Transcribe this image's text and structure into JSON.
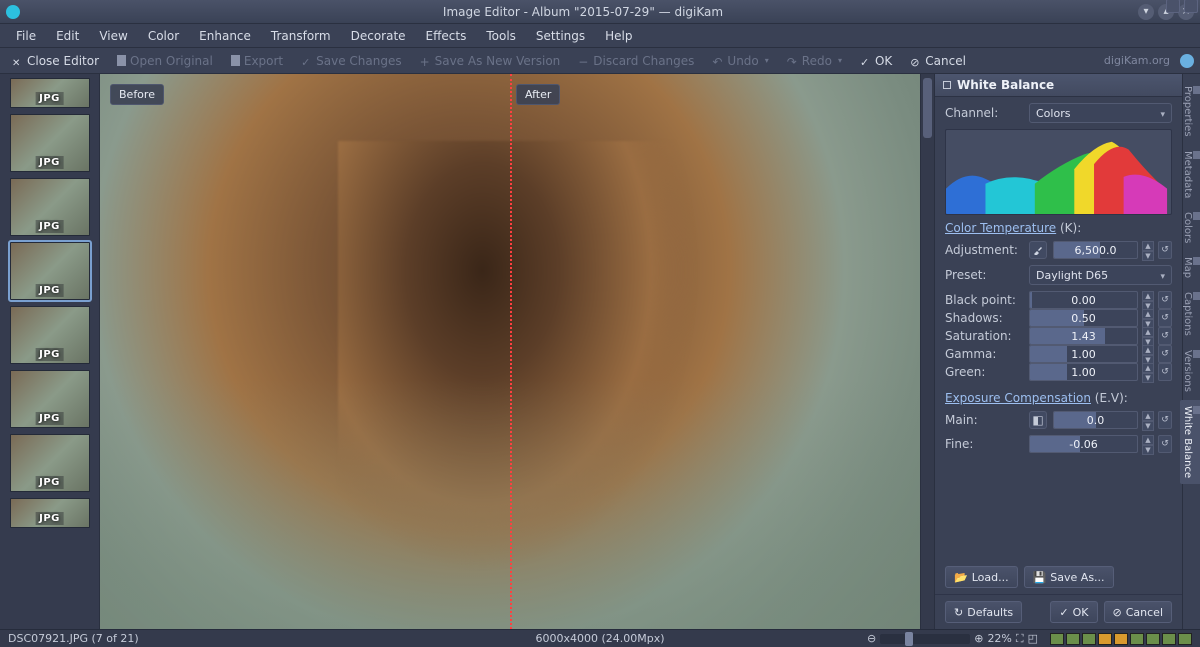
{
  "titlebar": {
    "title": "Image Editor - Album \"2015-07-29\" — digiKam"
  },
  "menubar": [
    "File",
    "Edit",
    "View",
    "Color",
    "Enhance",
    "Transform",
    "Decorate",
    "Effects",
    "Tools",
    "Settings",
    "Help"
  ],
  "toolbar": {
    "close": "Close Editor",
    "open": "Open Original",
    "export": "Export",
    "save": "Save Changes",
    "save_as": "Save As New Version",
    "discard": "Discard Changes",
    "undo": "Undo",
    "redo": "Redo",
    "ok": "OK",
    "cancel": "Cancel",
    "brand": "digiKam.org"
  },
  "thumbs": {
    "badge": "JPG",
    "count": 6
  },
  "canvas": {
    "before": "Before",
    "after": "After"
  },
  "panel": {
    "title": "White Balance",
    "channel_label": "Channel:",
    "channel_value": "Colors",
    "section_temp": "Color Temperature",
    "section_temp_unit": " (K):",
    "adjustment_label": "Adjustment:",
    "adjustment_value": "6,500.0",
    "preset_label": "Preset:",
    "preset_value": "Daylight D65",
    "params": [
      {
        "label": "Black point:",
        "value": "0.00",
        "fill": 2
      },
      {
        "label": "Shadows:",
        "value": "0.50",
        "fill": 50
      },
      {
        "label": "Saturation:",
        "value": "1.43",
        "fill": 70
      },
      {
        "label": "Gamma:",
        "value": "1.00",
        "fill": 35
      },
      {
        "label": "Green:",
        "value": "1.00",
        "fill": 35
      }
    ],
    "section_exp": "Exposure Compensation",
    "section_exp_unit": " (E.V):",
    "main_label": "Main:",
    "main_value": "0.0",
    "fine_label": "Fine:",
    "fine_value": "-0.06",
    "load": "Load...",
    "saveas": "Save As...",
    "defaults": "Defaults",
    "ok": "OK",
    "cancel": "Cancel"
  },
  "sidetabs": [
    "Properties",
    "Metadata",
    "Colors",
    "Map",
    "Captions",
    "Versions",
    "White Balance"
  ],
  "status": {
    "file": "DSC07921.JPG (7 of 21)",
    "dims": "6000x4000 (24.00Mpx)",
    "zoom": "22%",
    "swatches": [
      "#6b8f4a",
      "#6b8f4a",
      "#6b8f4a",
      "#d99a2e",
      "#d99a2e",
      "#6b8f4a",
      "#6b8f4a",
      "#6b8f4a",
      "#6b8f4a"
    ]
  }
}
